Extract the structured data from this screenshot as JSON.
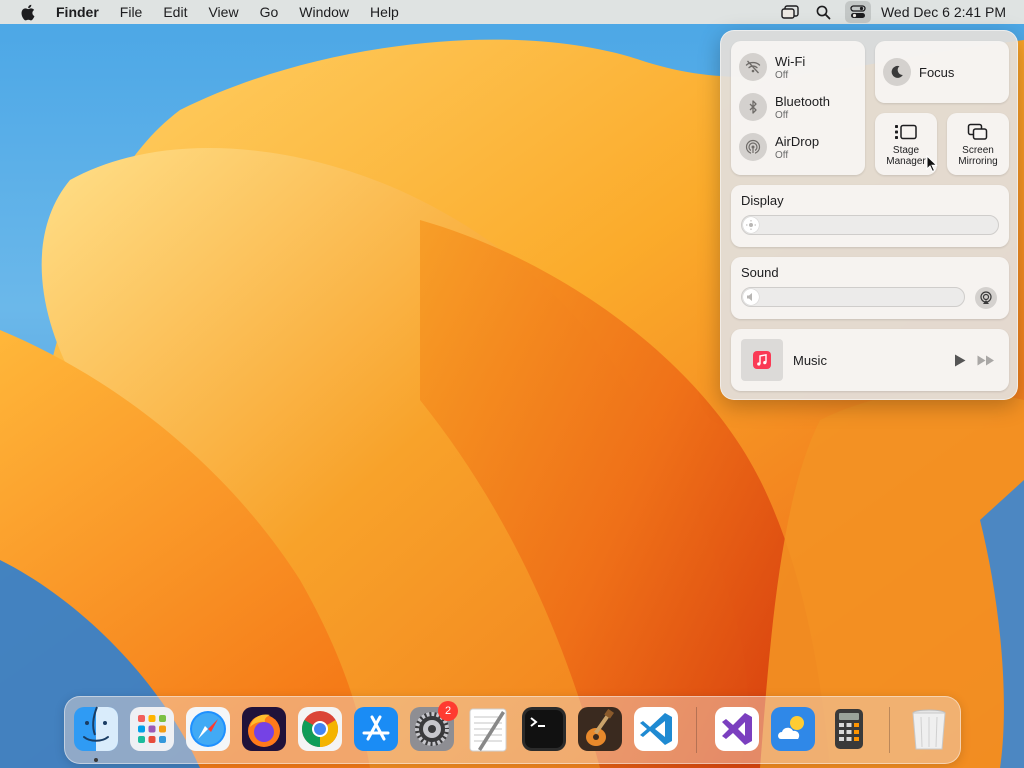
{
  "menubar": {
    "app_name": "Finder",
    "menus": [
      "File",
      "Edit",
      "View",
      "Go",
      "Window",
      "Help"
    ],
    "clock": "Wed Dec 6  2:41 PM",
    "icons": [
      "stage-manager-icon",
      "spotlight-search-icon",
      "control-center-icon"
    ]
  },
  "control_center": {
    "wifi": {
      "label": "Wi-Fi",
      "status": "Off"
    },
    "bluetooth": {
      "label": "Bluetooth",
      "status": "Off"
    },
    "airdrop": {
      "label": "AirDrop",
      "status": "Off"
    },
    "focus": {
      "label": "Focus"
    },
    "stage_manager": {
      "label": "Stage Manager"
    },
    "screen_mirroring": {
      "label": "Screen Mirroring"
    },
    "display": {
      "title": "Display",
      "brightness_level": 0
    },
    "sound": {
      "title": "Sound",
      "volume_level": 0
    },
    "music": {
      "label": "Music"
    }
  },
  "dock": {
    "apps": [
      {
        "name": "Finder",
        "running": true
      },
      {
        "name": "Launchpad"
      },
      {
        "name": "Safari"
      },
      {
        "name": "Firefox"
      },
      {
        "name": "Chrome"
      },
      {
        "name": "App Store"
      },
      {
        "name": "System Settings",
        "badge": "2"
      },
      {
        "name": "TextEdit"
      },
      {
        "name": "Terminal"
      },
      {
        "name": "GarageBand"
      },
      {
        "name": "Visual Studio Code"
      },
      {
        "name": "Visual Studio"
      },
      {
        "name": "Weather"
      },
      {
        "name": "Calculator"
      },
      {
        "name": "Trash"
      }
    ]
  },
  "colors": {
    "accent_red": "#ff3b30",
    "wallpaper_orange": "#f49a1c",
    "wallpaper_blue": "#4aa6e6"
  }
}
